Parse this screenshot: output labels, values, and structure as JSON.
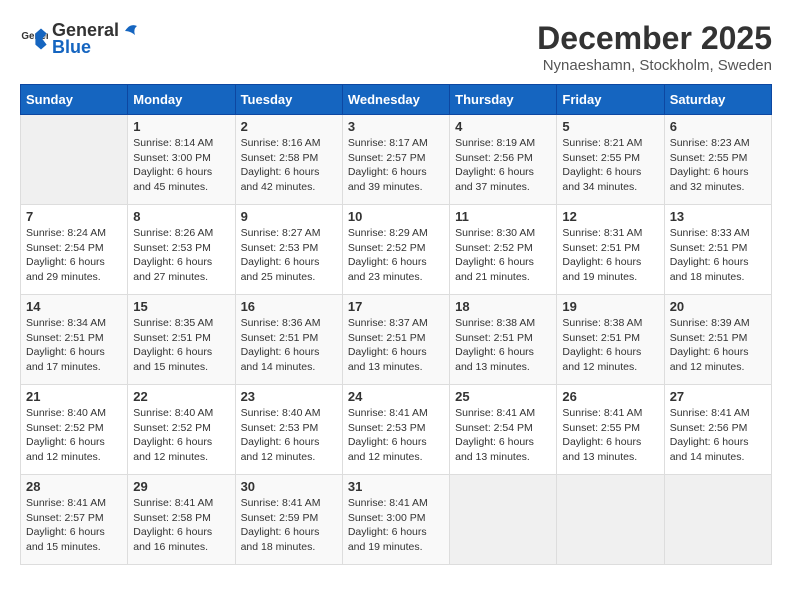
{
  "header": {
    "logo_general": "General",
    "logo_blue": "Blue",
    "month_title": "December 2025",
    "location": "Nynaeshamn, Stockholm, Sweden"
  },
  "days_of_week": [
    "Sunday",
    "Monday",
    "Tuesday",
    "Wednesday",
    "Thursday",
    "Friday",
    "Saturday"
  ],
  "weeks": [
    [
      {
        "day": "",
        "info": ""
      },
      {
        "day": "1",
        "info": "Sunrise: 8:14 AM\nSunset: 3:00 PM\nDaylight: 6 hours\nand 45 minutes."
      },
      {
        "day": "2",
        "info": "Sunrise: 8:16 AM\nSunset: 2:58 PM\nDaylight: 6 hours\nand 42 minutes."
      },
      {
        "day": "3",
        "info": "Sunrise: 8:17 AM\nSunset: 2:57 PM\nDaylight: 6 hours\nand 39 minutes."
      },
      {
        "day": "4",
        "info": "Sunrise: 8:19 AM\nSunset: 2:56 PM\nDaylight: 6 hours\nand 37 minutes."
      },
      {
        "day": "5",
        "info": "Sunrise: 8:21 AM\nSunset: 2:55 PM\nDaylight: 6 hours\nand 34 minutes."
      },
      {
        "day": "6",
        "info": "Sunrise: 8:23 AM\nSunset: 2:55 PM\nDaylight: 6 hours\nand 32 minutes."
      }
    ],
    [
      {
        "day": "7",
        "info": "Sunrise: 8:24 AM\nSunset: 2:54 PM\nDaylight: 6 hours\nand 29 minutes."
      },
      {
        "day": "8",
        "info": "Sunrise: 8:26 AM\nSunset: 2:53 PM\nDaylight: 6 hours\nand 27 minutes."
      },
      {
        "day": "9",
        "info": "Sunrise: 8:27 AM\nSunset: 2:53 PM\nDaylight: 6 hours\nand 25 minutes."
      },
      {
        "day": "10",
        "info": "Sunrise: 8:29 AM\nSunset: 2:52 PM\nDaylight: 6 hours\nand 23 minutes."
      },
      {
        "day": "11",
        "info": "Sunrise: 8:30 AM\nSunset: 2:52 PM\nDaylight: 6 hours\nand 21 minutes."
      },
      {
        "day": "12",
        "info": "Sunrise: 8:31 AM\nSunset: 2:51 PM\nDaylight: 6 hours\nand 19 minutes."
      },
      {
        "day": "13",
        "info": "Sunrise: 8:33 AM\nSunset: 2:51 PM\nDaylight: 6 hours\nand 18 minutes."
      }
    ],
    [
      {
        "day": "14",
        "info": "Sunrise: 8:34 AM\nSunset: 2:51 PM\nDaylight: 6 hours\nand 17 minutes."
      },
      {
        "day": "15",
        "info": "Sunrise: 8:35 AM\nSunset: 2:51 PM\nDaylight: 6 hours\nand 15 minutes."
      },
      {
        "day": "16",
        "info": "Sunrise: 8:36 AM\nSunset: 2:51 PM\nDaylight: 6 hours\nand 14 minutes."
      },
      {
        "day": "17",
        "info": "Sunrise: 8:37 AM\nSunset: 2:51 PM\nDaylight: 6 hours\nand 13 minutes."
      },
      {
        "day": "18",
        "info": "Sunrise: 8:38 AM\nSunset: 2:51 PM\nDaylight: 6 hours\nand 13 minutes."
      },
      {
        "day": "19",
        "info": "Sunrise: 8:38 AM\nSunset: 2:51 PM\nDaylight: 6 hours\nand 12 minutes."
      },
      {
        "day": "20",
        "info": "Sunrise: 8:39 AM\nSunset: 2:51 PM\nDaylight: 6 hours\nand 12 minutes."
      }
    ],
    [
      {
        "day": "21",
        "info": "Sunrise: 8:40 AM\nSunset: 2:52 PM\nDaylight: 6 hours\nand 12 minutes."
      },
      {
        "day": "22",
        "info": "Sunrise: 8:40 AM\nSunset: 2:52 PM\nDaylight: 6 hours\nand 12 minutes."
      },
      {
        "day": "23",
        "info": "Sunrise: 8:40 AM\nSunset: 2:53 PM\nDaylight: 6 hours\nand 12 minutes."
      },
      {
        "day": "24",
        "info": "Sunrise: 8:41 AM\nSunset: 2:53 PM\nDaylight: 6 hours\nand 12 minutes."
      },
      {
        "day": "25",
        "info": "Sunrise: 8:41 AM\nSunset: 2:54 PM\nDaylight: 6 hours\nand 13 minutes."
      },
      {
        "day": "26",
        "info": "Sunrise: 8:41 AM\nSunset: 2:55 PM\nDaylight: 6 hours\nand 13 minutes."
      },
      {
        "day": "27",
        "info": "Sunrise: 8:41 AM\nSunset: 2:56 PM\nDaylight: 6 hours\nand 14 minutes."
      }
    ],
    [
      {
        "day": "28",
        "info": "Sunrise: 8:41 AM\nSunset: 2:57 PM\nDaylight: 6 hours\nand 15 minutes."
      },
      {
        "day": "29",
        "info": "Sunrise: 8:41 AM\nSunset: 2:58 PM\nDaylight: 6 hours\nand 16 minutes."
      },
      {
        "day": "30",
        "info": "Sunrise: 8:41 AM\nSunset: 2:59 PM\nDaylight: 6 hours\nand 18 minutes."
      },
      {
        "day": "31",
        "info": "Sunrise: 8:41 AM\nSunset: 3:00 PM\nDaylight: 6 hours\nand 19 minutes."
      },
      {
        "day": "",
        "info": ""
      },
      {
        "day": "",
        "info": ""
      },
      {
        "day": "",
        "info": ""
      }
    ]
  ]
}
